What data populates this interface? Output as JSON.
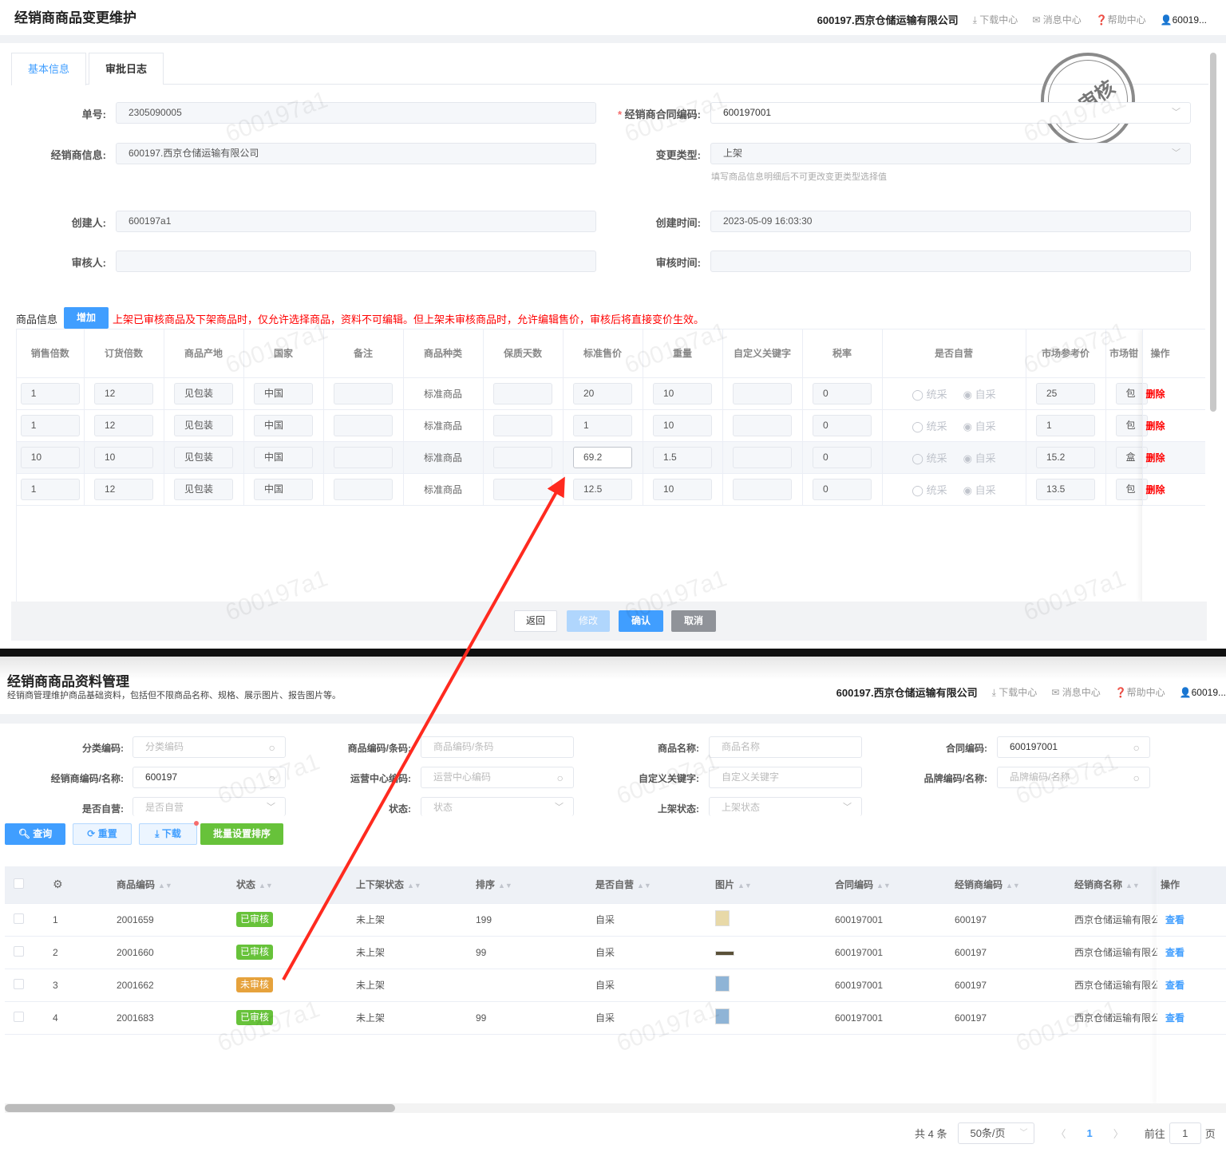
{
  "top": {
    "title": "经销商商品变更维护",
    "company": "600197.西京仓储运输有限公司",
    "nav": {
      "download": "下载中心",
      "message": "消息中心",
      "help": "帮助中心",
      "user": "60019..."
    },
    "tabs": [
      "基本信息",
      "审批日志"
    ],
    "stamp": "未审核",
    "form": {
      "order_no": {
        "label": "单号:",
        "value": "2305090005"
      },
      "contract": {
        "label": "经销商合同编码:",
        "value": "600197001"
      },
      "dealer": {
        "label": "经销商信息:",
        "value": "600197.西京仓储运输有限公司"
      },
      "change_type": {
        "label": "变更类型:",
        "value": "上架",
        "hint": "填写商品信息明细后不可更改变更类型选择值"
      },
      "creator": {
        "label": "创建人:",
        "value": "600197a1"
      },
      "created_at": {
        "label": "创建时间:",
        "value": "2023-05-09 16:03:30"
      },
      "reviewer": {
        "label": "审核人:",
        "value": ""
      },
      "reviewed_at": {
        "label": "审核时间:",
        "value": ""
      }
    },
    "goods_label": "商品信息",
    "add_button": "增加",
    "notice": "上架已审核商品及下架商品时，仅允许选择商品，资料不可编辑。但上架未审核商品时，允许编辑售价，审核后将直接变价生效。",
    "columns": [
      "销售倍数",
      "订货倍数",
      "商品产地",
      "国家",
      "备注",
      "商品种类",
      "保质天数",
      "标准售价",
      "重量",
      "自定义关键字",
      "税率",
      "是否自营",
      "市场参考价",
      "市场钳",
      "操作"
    ],
    "radio_options": [
      "统采",
      "自采"
    ],
    "delete_label": "删除",
    "rows": [
      [
        "1",
        "12",
        "见包装",
        "中国",
        "",
        "标准商品",
        "",
        "20",
        "10",
        "",
        "0",
        "25",
        "包"
      ],
      [
        "1",
        "12",
        "见包装",
        "中国",
        "",
        "标准商品",
        "",
        "1",
        "10",
        "",
        "0",
        "1",
        "包"
      ],
      [
        "10",
        "10",
        "见包装",
        "中国",
        "",
        "标准商品",
        "",
        "69.2",
        "1.5",
        "",
        "0",
        "15.2",
        "盒"
      ],
      [
        "1",
        "12",
        "见包装",
        "中国",
        "",
        "标准商品",
        "",
        "12.5",
        "10",
        "",
        "0",
        "13.5",
        "包"
      ]
    ],
    "buttons": {
      "back": "返回",
      "edit": "修改",
      "confirm": "确认",
      "cancel": "取消"
    }
  },
  "bottom": {
    "title": "经销商商品资料管理",
    "subtitle": "经销商管理维护商品基础资料，包括但不限商品名称、规格、展示图片、报告图片等。",
    "filters": [
      {
        "label": "分类编码:",
        "placeholder": "分类编码",
        "value": "",
        "icon": "search"
      },
      {
        "label": "商品编码/条码:",
        "placeholder": "商品编码/条码",
        "value": "",
        "icon": ""
      },
      {
        "label": "商品名称:",
        "placeholder": "商品名称",
        "value": "",
        "icon": ""
      },
      {
        "label": "合同编码:",
        "placeholder": "",
        "value": "600197001",
        "icon": "search"
      },
      {
        "label": "经销商编码/名称:",
        "placeholder": "",
        "value": "600197",
        "icon": "search"
      },
      {
        "label": "运营中心编码:",
        "placeholder": "运营中心编码",
        "value": "",
        "icon": "search"
      },
      {
        "label": "自定义关键字:",
        "placeholder": "自定义关键字",
        "value": "",
        "icon": ""
      },
      {
        "label": "品牌编码/名称:",
        "placeholder": "品牌编码/名称",
        "value": "",
        "icon": "search"
      },
      {
        "label": "是否自营:",
        "placeholder": "是否自营",
        "value": "",
        "icon": "chevron"
      },
      {
        "label": "状态:",
        "placeholder": "状态",
        "value": "",
        "icon": "chevron"
      },
      {
        "label": "上架状态:",
        "placeholder": "上架状态",
        "value": "",
        "icon": "chevron"
      }
    ],
    "actions": {
      "query": "查询",
      "reset": "重置",
      "download": "下载",
      "batch_sort": "批量设置排序"
    },
    "columns": [
      "商品编码",
      "状态",
      "上下架状态",
      "排序",
      "是否自营",
      "图片",
      "合同编码",
      "经销商编码",
      "经销商名称",
      "操作"
    ],
    "rows": [
      {
        "idx": "1",
        "code": "2001659",
        "status": "已审核",
        "shelf": "未上架",
        "sort": "199",
        "self": "自采",
        "contract": "600197001",
        "dealer_code": "600197",
        "dealer_name": "西京仓储运输有限公",
        "action": "查看"
      },
      {
        "idx": "2",
        "code": "2001660",
        "status": "已审核",
        "shelf": "未上架",
        "sort": "99",
        "self": "自采",
        "contract": "600197001",
        "dealer_code": "600197",
        "dealer_name": "西京仓储运输有限公",
        "action": "查看"
      },
      {
        "idx": "3",
        "code": "2001662",
        "status": "未审核",
        "shelf": "未上架",
        "sort": "",
        "self": "自采",
        "contract": "600197001",
        "dealer_code": "600197",
        "dealer_name": "西京仓储运输有限公",
        "action": "查看"
      },
      {
        "idx": "4",
        "code": "2001683",
        "status": "已审核",
        "shelf": "未上架",
        "sort": "99",
        "self": "自采",
        "contract": "600197001",
        "dealer_code": "600197",
        "dealer_name": "西京仓储运输有限公",
        "action": "查看"
      }
    ],
    "status_colors": {
      "已审核": "#67c23a",
      "未审核": "#e6a23c"
    },
    "pagination": {
      "total": "共 4 条",
      "page_size": "50条/页",
      "current": "1",
      "goto_label": "前往",
      "goto_value": "1",
      "page_suffix": "页"
    }
  },
  "watermark": "600197a1",
  "colors": {
    "primary": "#409eff",
    "success": "#67c23a",
    "danger": "#f00",
    "annotation": "#ff2a1f"
  }
}
